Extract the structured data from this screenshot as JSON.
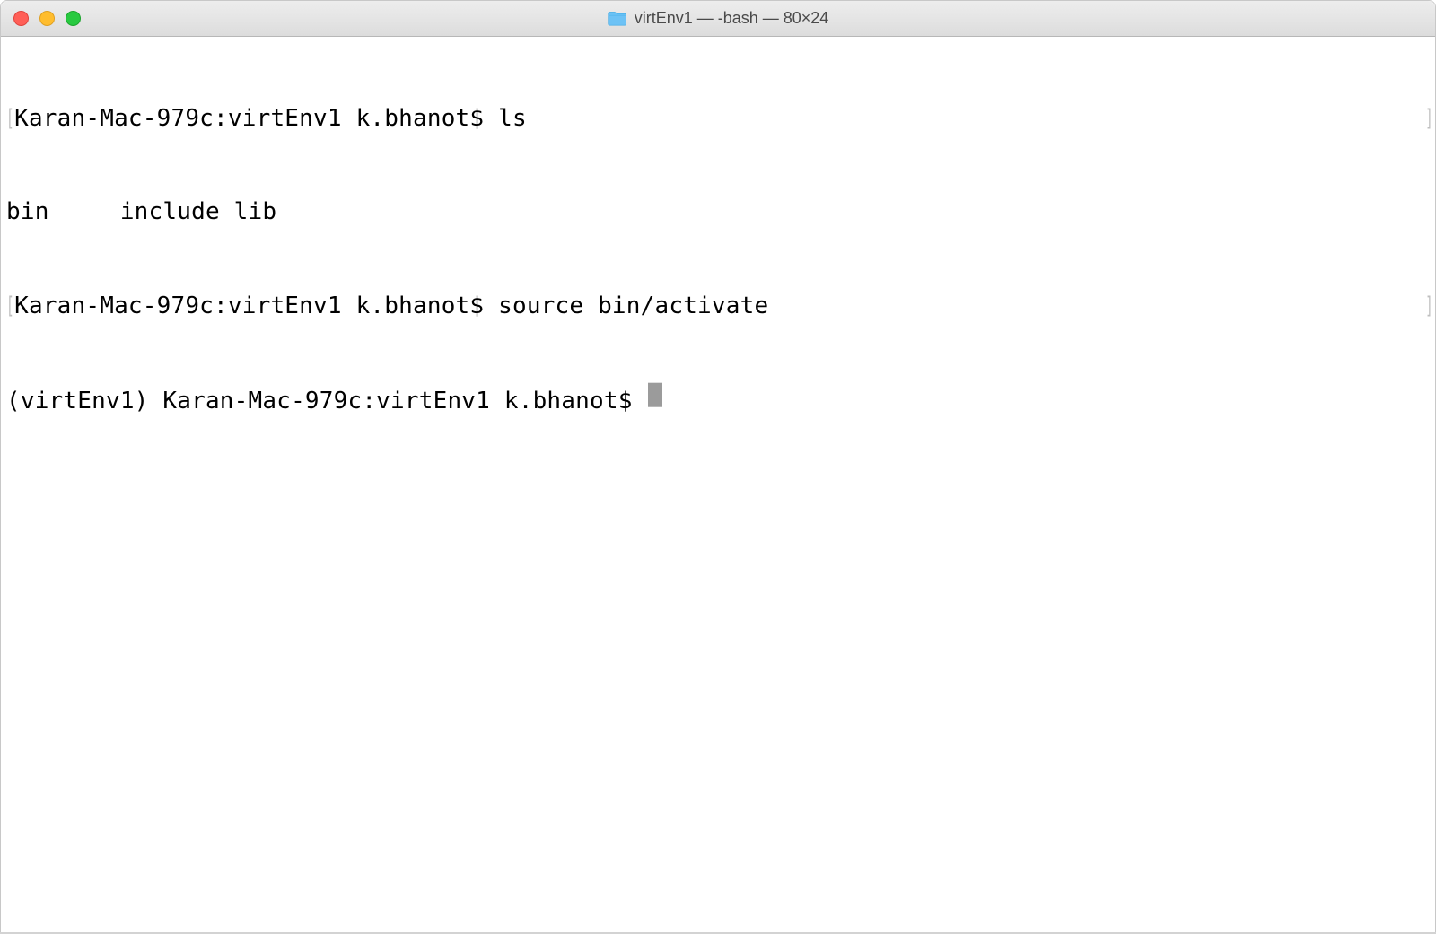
{
  "window": {
    "title": "virtEnv1 — -bash — 80×24",
    "icon": "folder-icon"
  },
  "terminal": {
    "lines": [
      {
        "bracketed": true,
        "prompt": "Karan-Mac-979c:virtEnv1 k.bhanot$ ",
        "command": "ls"
      },
      {
        "bracketed": false,
        "output": "bin     include lib"
      },
      {
        "bracketed": true,
        "prompt": "Karan-Mac-979c:virtEnv1 k.bhanot$ ",
        "command": "source bin/activate"
      },
      {
        "bracketed": false,
        "prompt": "(virtEnv1) Karan-Mac-979c:virtEnv1 k.bhanot$ ",
        "cursor": true
      }
    ]
  }
}
